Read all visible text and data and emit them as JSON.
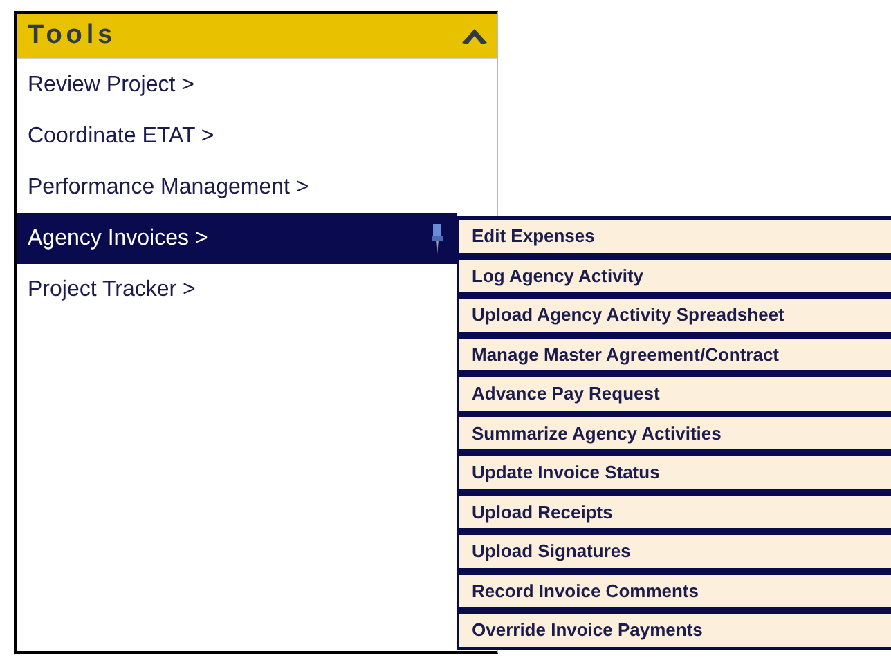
{
  "panel": {
    "title": "Tools",
    "expanded": true
  },
  "items": [
    {
      "label": "Review Project >",
      "selected": false,
      "pinned": false
    },
    {
      "label": "Coordinate ETAT >",
      "selected": false,
      "pinned": false
    },
    {
      "label": "Performance Management >",
      "selected": false,
      "pinned": false
    },
    {
      "label": "Agency Invoices >",
      "selected": true,
      "pinned": true
    },
    {
      "label": "Project Tracker >",
      "selected": false,
      "pinned": false
    }
  ],
  "submenu": {
    "items": [
      "Edit Expenses",
      "Log Agency Activity",
      "Upload Agency Activity Spreadsheet",
      "Manage Master Agreement/Contract",
      "Advance Pay Request",
      "Summarize Agency Activities",
      "Update Invoice Status",
      "Upload Receipts",
      "Upload Signatures",
      "Record Invoice Comments",
      "Override Invoice Payments"
    ]
  }
}
